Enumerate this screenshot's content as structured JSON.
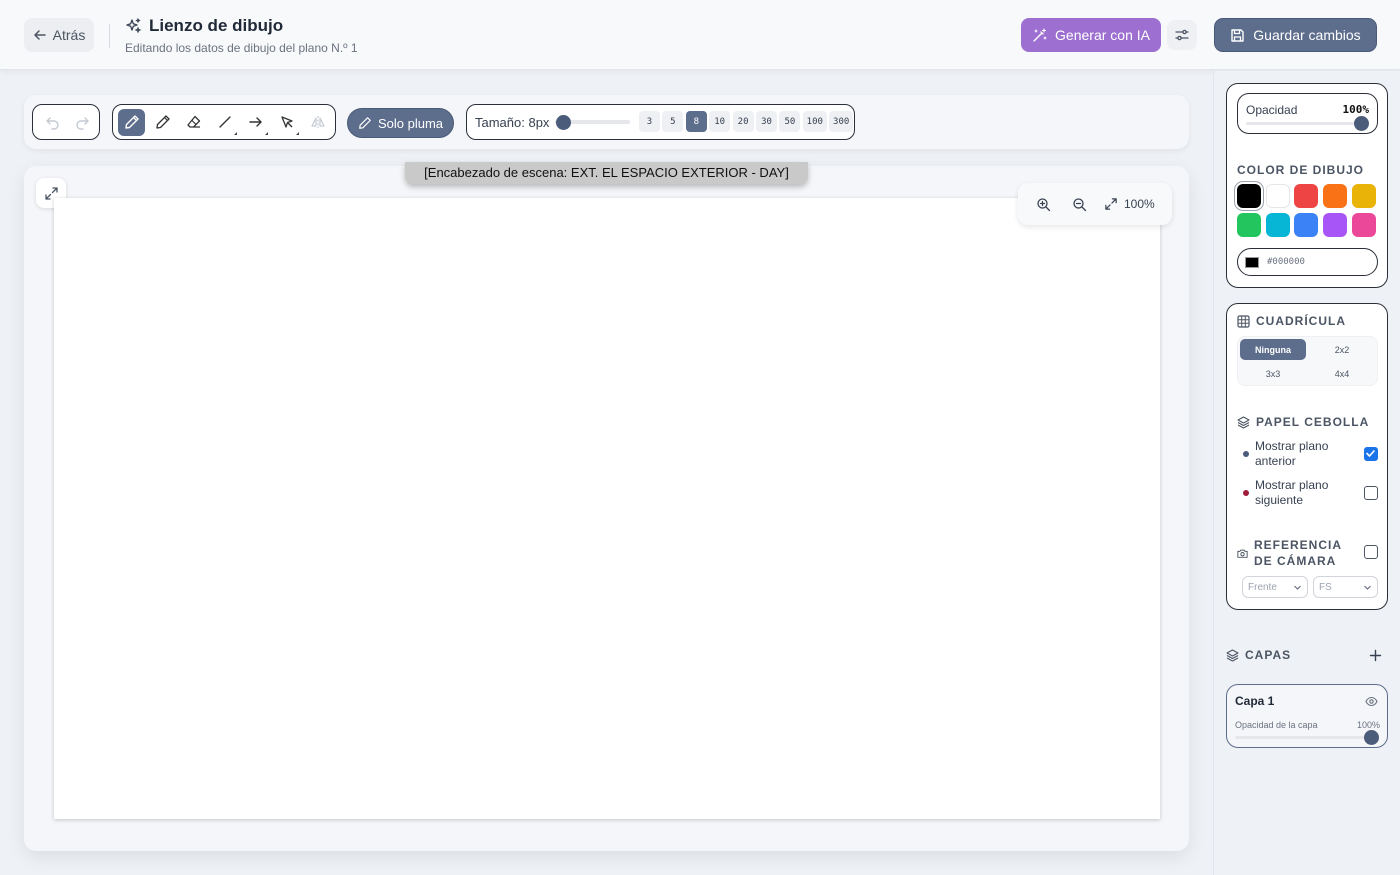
{
  "header": {
    "back_label": "Atrás",
    "title": "Lienzo de dibujo",
    "subtitle": "Editando los datos de dibujo del plano N.º 1",
    "ai_button": "Generar con IA",
    "save_button": "Guardar cambios"
  },
  "toolbar": {
    "tools": [
      "undo-icon",
      "redo-icon",
      "pen-icon",
      "pencil-icon",
      "eraser-icon",
      "line-icon",
      "arrow-icon",
      "select-icon",
      "mirror-icon"
    ],
    "active_tool": "pen-icon",
    "pen_only_label": "Solo pluma",
    "size_label": "Tamaño: 8px",
    "size_presets": [
      "3",
      "5",
      "8",
      "10",
      "20",
      "30",
      "50",
      "100",
      "300"
    ],
    "active_size": "8",
    "size_value": 8
  },
  "canvas": {
    "scene_heading": "[Encabezado de escena: EXT. EL ESPACIO EXTERIOR - DAY]",
    "zoom": "100%"
  },
  "sidebar": {
    "opacity_label": "Opacidad",
    "opacity_value": "100%",
    "opacity_fraction": 1.0,
    "color_title": "COLOR DE DIBUJO",
    "colors": [
      "#000000",
      "#ffffff",
      "#ef4444",
      "#f97316",
      "#eab308",
      "#22c55e",
      "#06b6d4",
      "#3b82f6",
      "#a855f7",
      "#ec4899"
    ],
    "selected_color": "#000000",
    "hex_value": "#000000",
    "grid_title": "CUADRÍCULA",
    "grid_options": [
      "Ninguna",
      "2x2",
      "3x3",
      "4x4"
    ],
    "grid_selected": "Ninguna",
    "onion_title": "PAPEL CEBOLLA",
    "onion_prev_label": "Mostrar plano anterior",
    "onion_prev_checked": true,
    "onion_prev_color": "#4b5b7a",
    "onion_next_label": "Mostrar plano siguiente",
    "onion_next_checked": false,
    "onion_next_color": "#9f1d3a",
    "camera_title": "REFERENCIA DE CÁMARA",
    "camera_checked": false,
    "camera_angle": "Frente",
    "camera_shot": "FS",
    "layers_title": "CAPAS",
    "layers": [
      {
        "name": "Capa 1",
        "opacity_label": "Opacidad de la capa",
        "opacity_value": "100%",
        "opacity_fraction": 1.0
      }
    ]
  }
}
